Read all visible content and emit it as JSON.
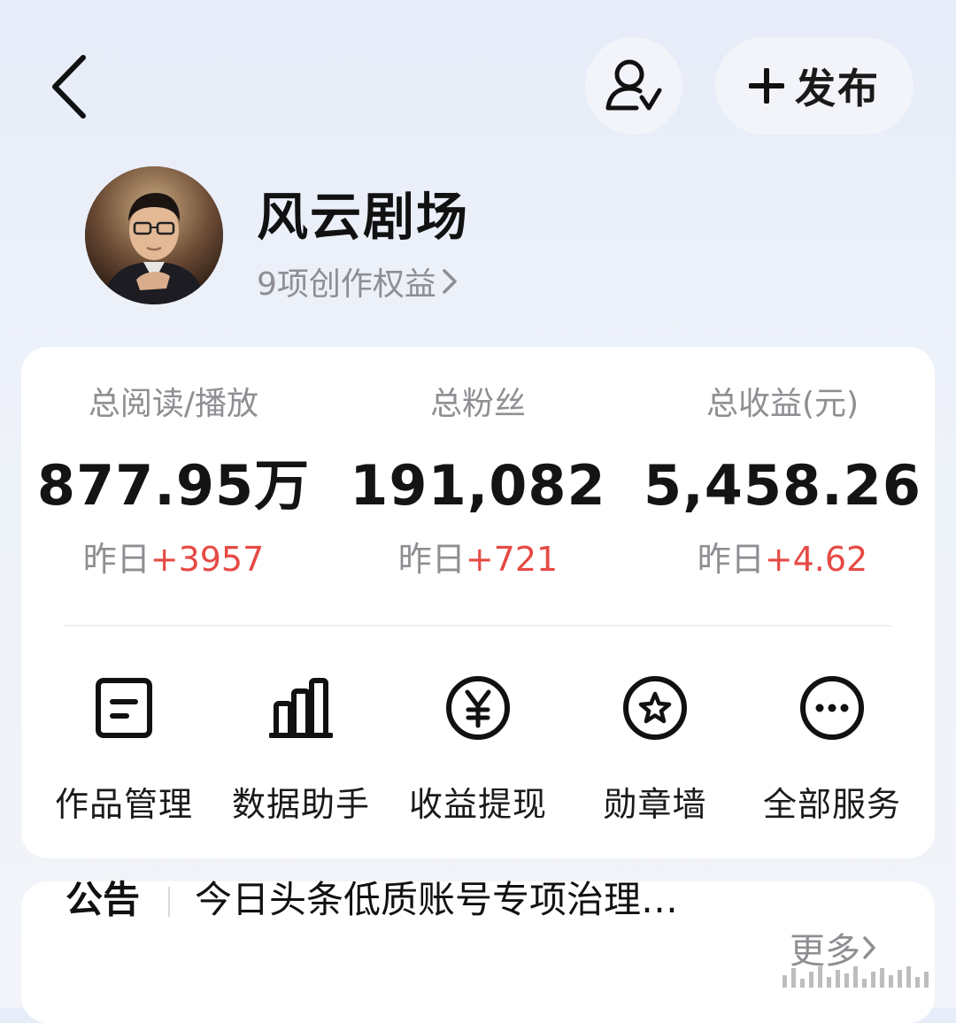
{
  "topbar": {
    "back_icon": "chevron-left-icon",
    "follow_icon": "user-check-icon",
    "publish_icon": "plus-icon",
    "publish_label": "发布"
  },
  "profile": {
    "name": "风云剧场",
    "rights": "9项创作权益"
  },
  "stats": [
    {
      "label": "总阅读/播放",
      "value": "877.95万",
      "delta_prefix": "昨日",
      "delta": "+3957"
    },
    {
      "label": "总粉丝",
      "value": "191,082",
      "delta_prefix": "昨日",
      "delta": "+721"
    },
    {
      "label": "总收益(元)",
      "value": "5,458.26",
      "delta_prefix": "昨日",
      "delta": "+4.62"
    }
  ],
  "services": [
    {
      "icon": "document-icon",
      "label": "作品管理"
    },
    {
      "icon": "bar-chart-icon",
      "label": "数据助手"
    },
    {
      "icon": "yen-coin-icon",
      "label": "收益提现"
    },
    {
      "icon": "star-badge-icon",
      "label": "勋章墙"
    },
    {
      "icon": "more-icon",
      "label": "全部服务"
    }
  ],
  "notice": {
    "tag": "公告",
    "text": "今日头条低质账号专项治理…",
    "more": "更多"
  },
  "colors": {
    "accent_red": "#e64a44",
    "muted_gray": "#8e8e93"
  }
}
